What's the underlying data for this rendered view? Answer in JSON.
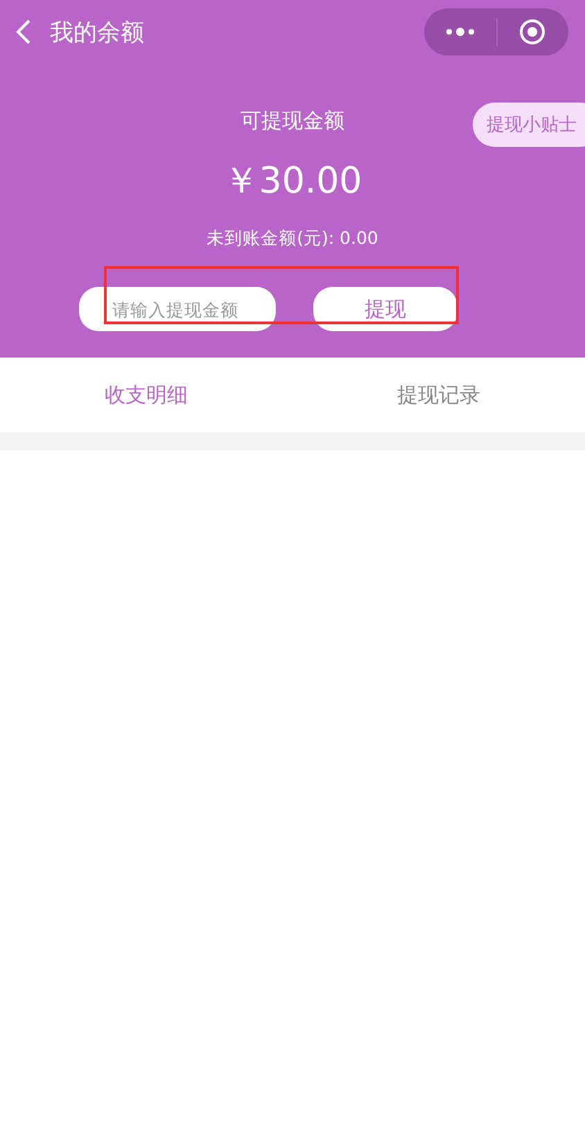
{
  "nav_bar": {
    "title": "我的余额"
  },
  "balance": {
    "label": "可提现金额",
    "amount": "￥30.00",
    "pending": "未到账金额(元): 0.00",
    "tips_button": "提现小贴士"
  },
  "withdraw_form": {
    "placeholder": "请输入提现金额",
    "button": "提现",
    "highlighted": true
  },
  "tabs": [
    {
      "label": "收支明细",
      "selected": true
    },
    {
      "label": "提现记录",
      "selected": false
    }
  ]
}
